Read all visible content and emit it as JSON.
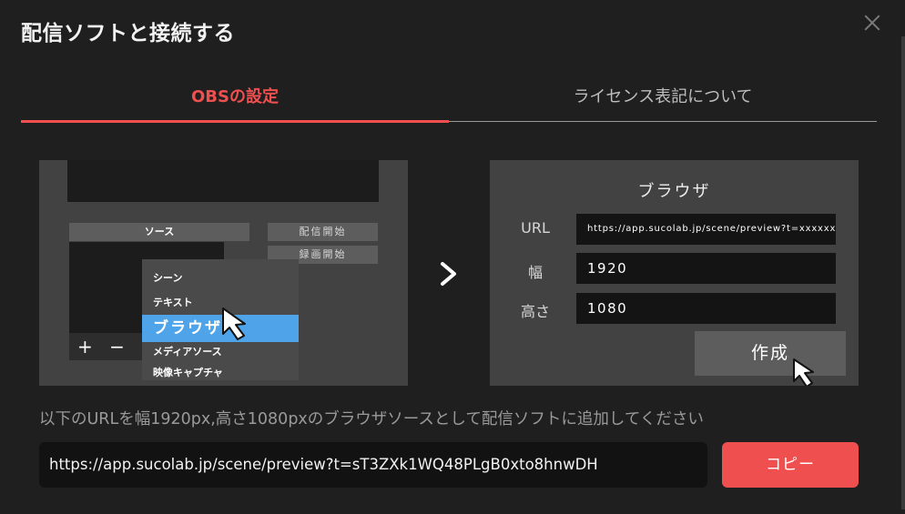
{
  "dialog": {
    "title": "配信ソフトと接続する"
  },
  "tabs": [
    {
      "label": "OBSの設定"
    },
    {
      "label": "ライセンス表記について"
    }
  ],
  "obs_illustration": {
    "sources_header": "ソース",
    "start_streaming": "配信開始",
    "start_recording": "録画開始",
    "add_remove": "+ −",
    "menu_items": [
      "シーン",
      "テキスト",
      "ブラウザ",
      "メディアソース",
      "映像キャプチャ"
    ]
  },
  "browser_source": {
    "title": "ブラウザ",
    "url_label": "URL",
    "url_value": "https://app.sucolab.jp/scene/preview?t=xxxxxx",
    "width_label": "幅",
    "width_value": "1920",
    "height_label": "高さ",
    "height_value": "1080",
    "create_button": "作成"
  },
  "instruction": "以下のURLを幅1920px,高さ1080pxのブラウザソースとして配信ソフトに追加してください",
  "url_field": {
    "value": "https://app.sucolab.jp/scene/preview?t=sT3ZXk1WQ48PLgB0xto8hnwDH"
  },
  "copy_button": "コピー",
  "colors": {
    "accent": "#ef4f4f",
    "selection": "#4fa3e8",
    "background": "#1f1f1f"
  }
}
